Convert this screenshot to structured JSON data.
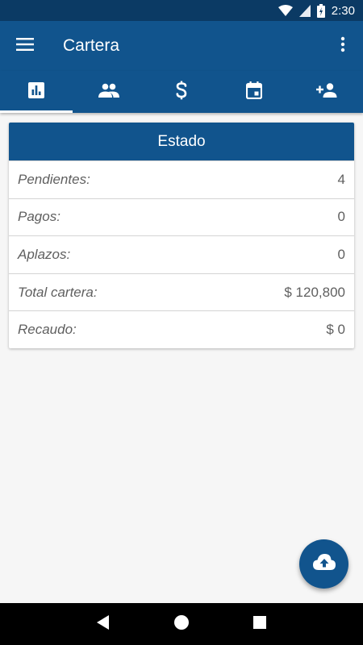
{
  "status_bar": {
    "time": "2:30"
  },
  "app_bar": {
    "title": "Cartera"
  },
  "tabs": [
    {
      "icon": "bar-chart-icon",
      "active": true
    },
    {
      "icon": "people-icon",
      "active": false
    },
    {
      "icon": "dollar-icon",
      "active": false
    },
    {
      "icon": "calendar-icon",
      "active": false
    },
    {
      "icon": "person-add-icon",
      "active": false
    }
  ],
  "card": {
    "title": "Estado",
    "rows": [
      {
        "label": "Pendientes:",
        "value": "4"
      },
      {
        "label": "Pagos:",
        "value": "0"
      },
      {
        "label": "Aplazos:",
        "value": "0"
      },
      {
        "label": "Total cartera:",
        "value": "$ 120,800"
      },
      {
        "label": "Recaudo:",
        "value": "$ 0"
      }
    ]
  },
  "fab": {
    "icon": "cloud-upload-icon"
  },
  "nav_bar": {
    "icons": [
      "back-icon",
      "home-icon",
      "recents-icon"
    ]
  },
  "colors": {
    "primary": "#11548d",
    "status_bar": "#0b3a64",
    "background": "#f6f6f6"
  }
}
